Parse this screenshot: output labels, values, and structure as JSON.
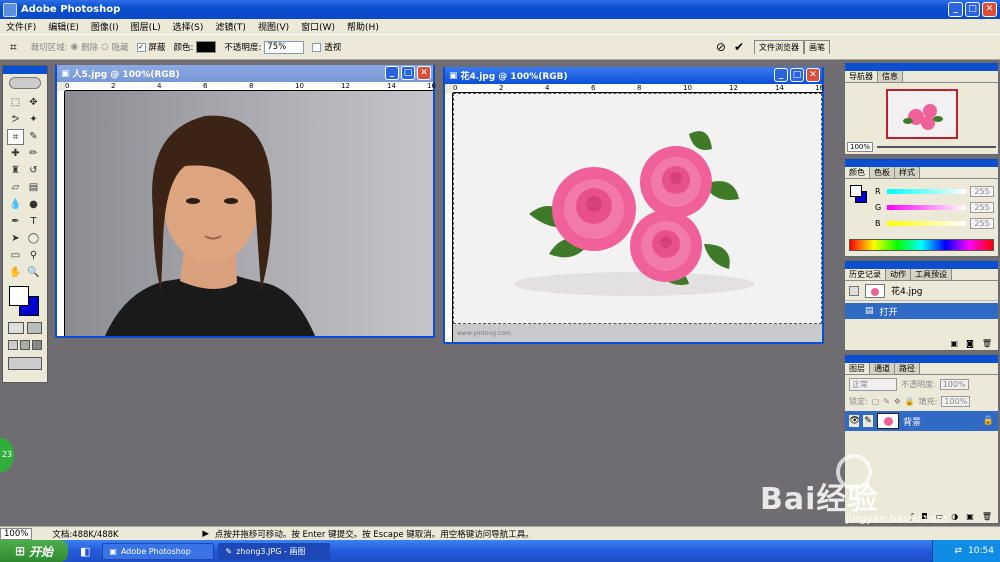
{
  "app": {
    "title": "Adobe Photoshop"
  },
  "menu": [
    "文件(F)",
    "编辑(E)",
    "图像(I)",
    "图层(L)",
    "选择(S)",
    "滤镜(T)",
    "视图(V)",
    "窗口(W)",
    "帮助(H)"
  ],
  "options": {
    "crop_area_label": "裁切区域:",
    "delete_label": "删除",
    "hide_label": "隐藏",
    "shield_label": "屏蔽",
    "color_label": "颜色:",
    "opacity_label": "不透明度:",
    "opacity_value": "75%",
    "perspective_label": "透视",
    "tab_file_browser": "文件浏览器",
    "tab_brushes": "画笔"
  },
  "doc1": {
    "title": "人5.jpg @ 100%(RGB)"
  },
  "doc2": {
    "title": "花4.jpg @ 100%(RGB)",
    "watermark": "www.ymtong.com"
  },
  "rulers": {
    "doc1_ticks": [
      "0",
      "2",
      "4",
      "6",
      "8",
      "10",
      "12",
      "14",
      "16"
    ],
    "doc2_ticks": [
      "0",
      "2",
      "4",
      "6",
      "8",
      "10",
      "12",
      "14",
      "16"
    ]
  },
  "navigator": {
    "tabs": [
      "导航器",
      "信息"
    ],
    "zoom": "100%"
  },
  "color_panel": {
    "tabs": [
      "颜色",
      "色板",
      "样式"
    ],
    "channels": [
      {
        "label": "R",
        "value": "255",
        "color": "#ff3333"
      },
      {
        "label": "G",
        "value": "255",
        "color": "#33cc33"
      },
      {
        "label": "B",
        "value": "255",
        "color": "#3333ff"
      }
    ]
  },
  "history_panel": {
    "tabs": [
      "历史记录",
      "动作",
      "工具预设"
    ],
    "snapshot": "花4.jpg",
    "step": "打开"
  },
  "layers_panel": {
    "tabs": [
      "图层",
      "通道",
      "路径"
    ],
    "blend_mode": "正常",
    "opacity_label": "不透明度:",
    "opacity_value": "100%",
    "lock_label": "锁定:",
    "fill_label": "填充:",
    "fill_value": "100%",
    "layer_name": "背景"
  },
  "status": {
    "zoom": "100%",
    "doc": "文档:488K/488K",
    "hint": "点按并拖移可移动。按 Enter 键提交。按 Escape 键取消。用空格键访问导航工具。"
  },
  "taskbar": {
    "start": "开始",
    "tasks": [
      "Adobe Photoshop",
      "zhong3.JPG - 画图"
    ],
    "time": "10:54"
  },
  "badge": {
    "text": "23"
  },
  "watermark": {
    "brand": "Bai经验",
    "url": "jingyan.baidu.com"
  }
}
